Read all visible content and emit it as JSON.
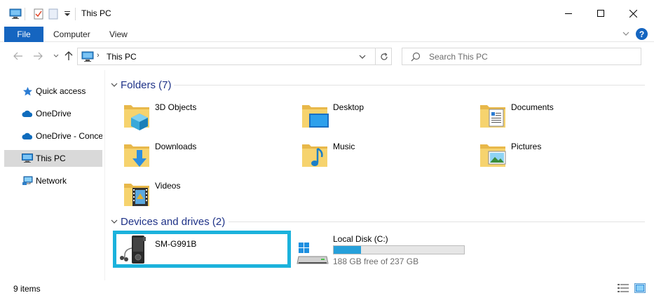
{
  "window": {
    "title": "This PC"
  },
  "ribbon": {
    "tabs": [
      {
        "label": "File"
      },
      {
        "label": "Computer"
      },
      {
        "label": "View"
      }
    ],
    "accent": "#1565c0"
  },
  "nav": {
    "address": {
      "path": "This PC"
    },
    "search": {
      "placeholder": "Search This PC"
    }
  },
  "sidebar": {
    "items": [
      {
        "label": "Quick access",
        "icon": "star-icon"
      },
      {
        "label": "OneDrive",
        "icon": "cloud-icon"
      },
      {
        "label": "OneDrive - Conce",
        "icon": "cloud-icon"
      },
      {
        "label": "This PC",
        "icon": "computer-icon",
        "selected": true
      },
      {
        "label": "Network",
        "icon": "network-icon"
      }
    ]
  },
  "folders_group": {
    "header": "Folders (7)",
    "items": [
      {
        "name": "3D Objects",
        "icon": "3d-objects-folder-icon"
      },
      {
        "name": "Desktop",
        "icon": "desktop-folder-icon"
      },
      {
        "name": "Documents",
        "icon": "documents-folder-icon"
      },
      {
        "name": "Downloads",
        "icon": "downloads-folder-icon"
      },
      {
        "name": "Music",
        "icon": "music-folder-icon"
      },
      {
        "name": "Pictures",
        "icon": "pictures-folder-icon"
      },
      {
        "name": "Videos",
        "icon": "videos-folder-icon"
      }
    ]
  },
  "devices_group": {
    "header": "Devices and drives (2)",
    "items": [
      {
        "name": "SM-G991B",
        "icon": "phone-device-icon"
      },
      {
        "name": "Local Disk (C:)",
        "icon": "hard-drive-icon",
        "free_text": "188 GB free of 237 GB",
        "used_fraction": 0.207
      }
    ]
  },
  "status": {
    "item_count": "9 items"
  }
}
